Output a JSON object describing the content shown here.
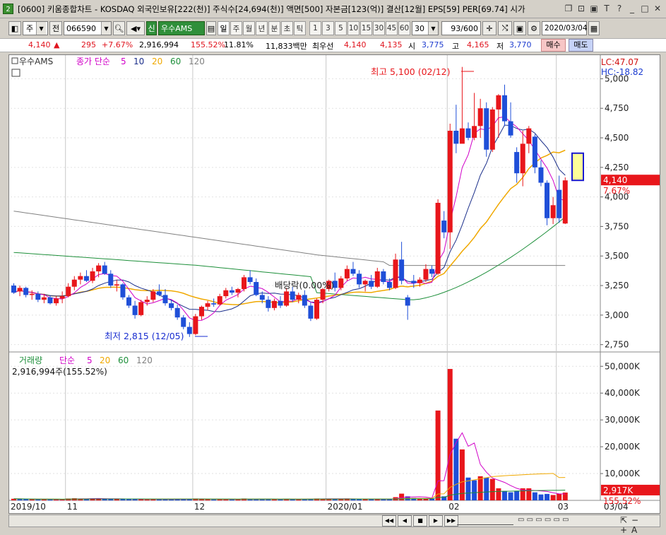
{
  "titlebar": {
    "app_icon": "2",
    "text": "[0600] 키움종합차트 - KOSDAQ 외국인보유[222(천)] 주식수[24,694(천)] 액면[500] 자본금[123(억)] 결산[12월] EPS[59] PER[69.74] 시가",
    "icons": [
      "restore-icon",
      "pin-icon",
      "minimize-icon",
      "text-icon",
      "help-icon",
      "min-icon",
      "max-icon",
      "close-icon"
    ],
    "icon_glyphs": [
      "❐",
      "⊡",
      "▣",
      "T",
      "?",
      "_",
      "□",
      "✕"
    ]
  },
  "toolbar": {
    "period_type": "주",
    "prev_label": "전",
    "code": "066590",
    "name": "우수AMS",
    "sin_label": "신",
    "periods": [
      "일",
      "주",
      "월",
      "년",
      "분",
      "초",
      "틱"
    ],
    "active_period": "일",
    "minutes": [
      "1",
      "3",
      "5",
      "10",
      "15",
      "30",
      "45",
      "60"
    ],
    "minute_value": "30",
    "count": "93/600",
    "date": "2020/03/04"
  },
  "quote": {
    "price": "4,140",
    "change": "295",
    "change_pct": "+7.67%",
    "volume": "2,916,994",
    "volume_ratio": "155.52%",
    "turnover": "11.81%",
    "amount": "11,833백만",
    "pref_label": "최우선",
    "ask": "4,140",
    "bid": "4,135",
    "open_label": "시",
    "open": "3,775",
    "high_label": "고",
    "high": "4,165",
    "low_label": "저",
    "low": "3,770",
    "buy_label": "매수",
    "sell_label": "매도"
  },
  "price_panel": {
    "stock_label": "우수AMS",
    "ma_label": "종가 단순",
    "ma_periods": [
      "5",
      "10",
      "20",
      "60",
      "120"
    ],
    "lc_label": "LC:47.07",
    "hc_label": "HC:-18.82",
    "high_annotation": "최고 5,100 (02/12)",
    "low_annotation": "최저 2,815 (12/05)",
    "event_annotation": "배당락(0.00%)",
    "price_tag": "4,140",
    "pct_tag": "7.67%",
    "y_ticks": [
      "5,000",
      "4,750",
      "4,500",
      "4,250",
      "4,000",
      "3,750",
      "3,500",
      "3,250",
      "3,000",
      "2,750"
    ],
    "colors": {
      "up": "#e8161b",
      "down": "#1f4fd8",
      "ma5": "#d100c8",
      "ma10": "#1a2e8a",
      "ma20": "#f0a800",
      "ma60": "#1d8f3a",
      "ma120": "#808080"
    }
  },
  "volume_panel": {
    "label": "거래량",
    "ma_label": "단순",
    "ma_periods": [
      "5",
      "20",
      "60",
      "120"
    ],
    "value_text": "2,916,994주(155.52%)",
    "y_ticks": [
      "50,000K",
      "40,000K",
      "30,000K",
      "20,000K",
      "10,000K"
    ],
    "vol_tag": "2,917K",
    "pct_tag": "155.52%"
  },
  "x_axis": {
    "labels": [
      "2019/10",
      "11",
      "12",
      "2020/01",
      "02",
      "03"
    ],
    "right_label": "03/04"
  },
  "chart_data": {
    "type": "candlestick",
    "ylim": [
      2750,
      5100
    ],
    "candles": [
      {
        "o": 3250,
        "h": 3270,
        "l": 3180,
        "c": 3190
      },
      {
        "o": 3200,
        "h": 3250,
        "l": 3160,
        "c": 3230
      },
      {
        "o": 3230,
        "h": 3240,
        "l": 3150,
        "c": 3170
      },
      {
        "o": 3170,
        "h": 3210,
        "l": 3130,
        "c": 3180
      },
      {
        "o": 3180,
        "h": 3200,
        "l": 3110,
        "c": 3130
      },
      {
        "o": 3130,
        "h": 3180,
        "l": 3100,
        "c": 3150
      },
      {
        "o": 3150,
        "h": 3170,
        "l": 3090,
        "c": 3100
      },
      {
        "o": 3100,
        "h": 3160,
        "l": 3080,
        "c": 3140
      },
      {
        "o": 3140,
        "h": 3200,
        "l": 3100,
        "c": 3160
      },
      {
        "o": 3160,
        "h": 3270,
        "l": 3150,
        "c": 3240
      },
      {
        "o": 3240,
        "h": 3330,
        "l": 3210,
        "c": 3300
      },
      {
        "o": 3300,
        "h": 3360,
        "l": 3260,
        "c": 3330
      },
      {
        "o": 3330,
        "h": 3380,
        "l": 3280,
        "c": 3290
      },
      {
        "o": 3290,
        "h": 3400,
        "l": 3270,
        "c": 3370
      },
      {
        "o": 3370,
        "h": 3440,
        "l": 3320,
        "c": 3420
      },
      {
        "o": 3420,
        "h": 3450,
        "l": 3340,
        "c": 3350
      },
      {
        "o": 3350,
        "h": 3380,
        "l": 3230,
        "c": 3250
      },
      {
        "o": 3250,
        "h": 3300,
        "l": 3200,
        "c": 3260
      },
      {
        "o": 3260,
        "h": 3270,
        "l": 3130,
        "c": 3150
      },
      {
        "o": 3150,
        "h": 3170,
        "l": 3060,
        "c": 3080
      },
      {
        "o": 3080,
        "h": 3120,
        "l": 2970,
        "c": 3000
      },
      {
        "o": 3000,
        "h": 3130,
        "l": 2990,
        "c": 3110
      },
      {
        "o": 3110,
        "h": 3160,
        "l": 3080,
        "c": 3130
      },
      {
        "o": 3130,
        "h": 3220,
        "l": 3110,
        "c": 3200
      },
      {
        "o": 3200,
        "h": 3260,
        "l": 3160,
        "c": 3170
      },
      {
        "o": 3170,
        "h": 3220,
        "l": 3080,
        "c": 3100
      },
      {
        "o": 3100,
        "h": 3130,
        "l": 3040,
        "c": 3060
      },
      {
        "o": 3060,
        "h": 3090,
        "l": 2960,
        "c": 2980
      },
      {
        "o": 2980,
        "h": 3000,
        "l": 2880,
        "c": 2900
      },
      {
        "o": 2900,
        "h": 2940,
        "l": 2815,
        "c": 2840
      },
      {
        "o": 2840,
        "h": 3010,
        "l": 2830,
        "c": 2990
      },
      {
        "o": 2990,
        "h": 3080,
        "l": 2960,
        "c": 3070
      },
      {
        "o": 3070,
        "h": 3120,
        "l": 3040,
        "c": 3100
      },
      {
        "o": 3100,
        "h": 3140,
        "l": 3070,
        "c": 3090
      },
      {
        "o": 3090,
        "h": 3180,
        "l": 3080,
        "c": 3160
      },
      {
        "o": 3160,
        "h": 3230,
        "l": 3140,
        "c": 3210
      },
      {
        "o": 3210,
        "h": 3240,
        "l": 3170,
        "c": 3190
      },
      {
        "o": 3190,
        "h": 3230,
        "l": 3150,
        "c": 3220
      },
      {
        "o": 3220,
        "h": 3340,
        "l": 3200,
        "c": 3320
      },
      {
        "o": 3320,
        "h": 3380,
        "l": 3260,
        "c": 3280
      },
      {
        "o": 3280,
        "h": 3310,
        "l": 3160,
        "c": 3170
      },
      {
        "o": 3170,
        "h": 3200,
        "l": 3100,
        "c": 3130
      },
      {
        "o": 3130,
        "h": 3160,
        "l": 3030,
        "c": 3060
      },
      {
        "o": 3060,
        "h": 3140,
        "l": 3040,
        "c": 3120
      },
      {
        "o": 3120,
        "h": 3160,
        "l": 3060,
        "c": 3080
      },
      {
        "o": 3080,
        "h": 3230,
        "l": 3070,
        "c": 3200
      },
      {
        "o": 3200,
        "h": 3240,
        "l": 3110,
        "c": 3130
      },
      {
        "o": 3130,
        "h": 3190,
        "l": 3100,
        "c": 3170
      },
      {
        "o": 3170,
        "h": 3210,
        "l": 3060,
        "c": 3080
      },
      {
        "o": 3080,
        "h": 3110,
        "l": 2950,
        "c": 2970
      },
      {
        "o": 2970,
        "h": 3140,
        "l": 2960,
        "c": 3130
      },
      {
        "o": 3130,
        "h": 3230,
        "l": 3100,
        "c": 3220
      },
      {
        "o": 3220,
        "h": 3300,
        "l": 3200,
        "c": 3290
      },
      {
        "o": 3290,
        "h": 3360,
        "l": 3200,
        "c": 3230
      },
      {
        "o": 3230,
        "h": 3330,
        "l": 3210,
        "c": 3310
      },
      {
        "o": 3310,
        "h": 3420,
        "l": 3290,
        "c": 3390
      },
      {
        "o": 3390,
        "h": 3450,
        "l": 3330,
        "c": 3350
      },
      {
        "o": 3350,
        "h": 3380,
        "l": 3230,
        "c": 3260
      },
      {
        "o": 3260,
        "h": 3300,
        "l": 3200,
        "c": 3290
      },
      {
        "o": 3290,
        "h": 3340,
        "l": 3220,
        "c": 3240
      },
      {
        "o": 3240,
        "h": 3400,
        "l": 3230,
        "c": 3370
      },
      {
        "o": 3370,
        "h": 3390,
        "l": 3260,
        "c": 3280
      },
      {
        "o": 3280,
        "h": 3310,
        "l": 3210,
        "c": 3230
      },
      {
        "o": 3230,
        "h": 3520,
        "l": 3220,
        "c": 3470
      },
      {
        "o": 3470,
        "h": 3620,
        "l": 3260,
        "c": 3290
      },
      {
        "o": 3150,
        "h": 3170,
        "l": 2960,
        "c": 3080
      },
      {
        "o": 3290,
        "h": 3340,
        "l": 3230,
        "c": 3270
      },
      {
        "o": 3270,
        "h": 3320,
        "l": 3240,
        "c": 3300
      },
      {
        "o": 3300,
        "h": 3430,
        "l": 3280,
        "c": 3390
      },
      {
        "o": 3390,
        "h": 3420,
        "l": 3320,
        "c": 3350
      },
      {
        "o": 3350,
        "h": 3980,
        "l": 3340,
        "c": 3950
      },
      {
        "o": 3800,
        "h": 3880,
        "l": 3650,
        "c": 3700
      },
      {
        "o": 3700,
        "h": 4620,
        "l": 3560,
        "c": 4560
      },
      {
        "o": 4560,
        "h": 4780,
        "l": 4370,
        "c": 4450
      },
      {
        "o": 4450,
        "h": 5100,
        "l": 4480,
        "c": 4580
      },
      {
        "o": 4580,
        "h": 4630,
        "l": 4480,
        "c": 4500
      },
      {
        "o": 4500,
        "h": 4880,
        "l": 4480,
        "c": 4600
      },
      {
        "o": 4600,
        "h": 4830,
        "l": 4500,
        "c": 4750
      },
      {
        "o": 4750,
        "h": 4800,
        "l": 4340,
        "c": 4400
      },
      {
        "o": 4400,
        "h": 4760,
        "l": 4380,
        "c": 4740
      },
      {
        "o": 4740,
        "h": 4870,
        "l": 4500,
        "c": 4860
      },
      {
        "o": 4860,
        "h": 4950,
        "l": 4600,
        "c": 4640
      },
      {
        "o": 4640,
        "h": 4800,
        "l": 4500,
        "c": 4520
      },
      {
        "o": 4380,
        "h": 4420,
        "l": 4120,
        "c": 4200
      },
      {
        "o": 4200,
        "h": 4560,
        "l": 4090,
        "c": 4450
      },
      {
        "o": 4450,
        "h": 4600,
        "l": 4370,
        "c": 4580
      },
      {
        "o": 4510,
        "h": 4530,
        "l": 4200,
        "c": 4250
      },
      {
        "o": 4250,
        "h": 4310,
        "l": 4090,
        "c": 4120
      },
      {
        "o": 4120,
        "h": 4140,
        "l": 3760,
        "c": 3820
      },
      {
        "o": 3820,
        "h": 4000,
        "l": 3770,
        "c": 3930
      },
      {
        "o": 4060,
        "h": 4180,
        "l": 3780,
        "c": 3820
      },
      {
        "o": 3775,
        "h": 4165,
        "l": 3770,
        "c": 4140
      }
    ],
    "volume": [
      {
        "v": 600,
        "up": true
      },
      {
        "v": 500,
        "up": false
      },
      {
        "v": 500,
        "up": false
      },
      {
        "v": 400,
        "up": true
      },
      {
        "v": 400,
        "up": false
      },
      {
        "v": 400,
        "up": true
      },
      {
        "v": 350,
        "up": false
      },
      {
        "v": 350,
        "up": true
      },
      {
        "v": 400,
        "up": true
      },
      {
        "v": 700,
        "up": true
      },
      {
        "v": 800,
        "up": true
      },
      {
        "v": 600,
        "up": true
      },
      {
        "v": 500,
        "up": false
      },
      {
        "v": 700,
        "up": true
      },
      {
        "v": 800,
        "up": true
      },
      {
        "v": 500,
        "up": false
      },
      {
        "v": 500,
        "up": false
      },
      {
        "v": 450,
        "up": true
      },
      {
        "v": 500,
        "up": false
      },
      {
        "v": 500,
        "up": false
      },
      {
        "v": 500,
        "up": false
      },
      {
        "v": 450,
        "up": true
      },
      {
        "v": 350,
        "up": true
      },
      {
        "v": 450,
        "up": true
      },
      {
        "v": 400,
        "up": false
      },
      {
        "v": 400,
        "up": false
      },
      {
        "v": 350,
        "up": false
      },
      {
        "v": 500,
        "up": false
      },
      {
        "v": 500,
        "up": false
      },
      {
        "v": 600,
        "up": false
      },
      {
        "v": 700,
        "up": true
      },
      {
        "v": 500,
        "up": true
      },
      {
        "v": 400,
        "up": true
      },
      {
        "v": 350,
        "up": false
      },
      {
        "v": 450,
        "up": true
      },
      {
        "v": 450,
        "up": true
      },
      {
        "v": 350,
        "up": false
      },
      {
        "v": 350,
        "up": true
      },
      {
        "v": 700,
        "up": true
      },
      {
        "v": 500,
        "up": false
      },
      {
        "v": 500,
        "up": false
      },
      {
        "v": 400,
        "up": false
      },
      {
        "v": 500,
        "up": false
      },
      {
        "v": 400,
        "up": true
      },
      {
        "v": 350,
        "up": false
      },
      {
        "v": 600,
        "up": true
      },
      {
        "v": 450,
        "up": false
      },
      {
        "v": 350,
        "up": true
      },
      {
        "v": 500,
        "up": false
      },
      {
        "v": 600,
        "up": false
      },
      {
        "v": 700,
        "up": true
      },
      {
        "v": 600,
        "up": true
      },
      {
        "v": 600,
        "up": true
      },
      {
        "v": 500,
        "up": false
      },
      {
        "v": 500,
        "up": true
      },
      {
        "v": 700,
        "up": true
      },
      {
        "v": 500,
        "up": false
      },
      {
        "v": 500,
        "up": false
      },
      {
        "v": 400,
        "up": true
      },
      {
        "v": 400,
        "up": false
      },
      {
        "v": 600,
        "up": true
      },
      {
        "v": 500,
        "up": false
      },
      {
        "v": 400,
        "up": false
      },
      {
        "v": 1200,
        "up": true
      },
      {
        "v": 2500,
        "up": true
      },
      {
        "v": 1500,
        "up": false
      },
      {
        "v": 900,
        "up": false
      },
      {
        "v": 500,
        "up": true
      },
      {
        "v": 700,
        "up": true
      },
      {
        "v": 600,
        "up": false
      },
      {
        "v": 33500,
        "up": true
      },
      {
        "v": 1500,
        "up": false
      },
      {
        "v": 49000,
        "up": true
      },
      {
        "v": 23000,
        "up": false
      },
      {
        "v": 19000,
        "up": true
      },
      {
        "v": 8500,
        "up": false
      },
      {
        "v": 7500,
        "up": false
      },
      {
        "v": 9000,
        "up": true
      },
      {
        "v": 8500,
        "up": false
      },
      {
        "v": 8000,
        "up": true
      },
      {
        "v": 4500,
        "up": true
      },
      {
        "v": 3500,
        "up": false
      },
      {
        "v": 3000,
        "up": false
      },
      {
        "v": 3500,
        "up": false
      },
      {
        "v": 4500,
        "up": true
      },
      {
        "v": 4500,
        "up": true
      },
      {
        "v": 3000,
        "up": false
      },
      {
        "v": 2200,
        "up": false
      },
      {
        "v": 2400,
        "up": false
      },
      {
        "v": 2000,
        "up": true
      },
      {
        "v": 2500,
        "up": true
      },
      {
        "v": 2917,
        "up": true
      }
    ],
    "volume_ylim": [
      0,
      52000
    ]
  },
  "scrollbar": {
    "buttons": [
      "◀◀",
      "◀",
      "■",
      "▶",
      "▶▶"
    ]
  }
}
